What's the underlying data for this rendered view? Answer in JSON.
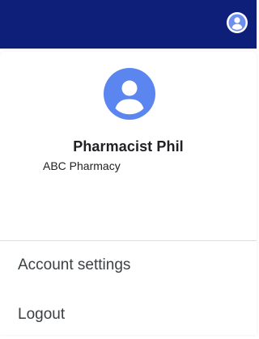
{
  "header": {
    "avatar_icon": "account-circle-icon",
    "background_color": "#0d1f78"
  },
  "account_menu": {
    "avatar_icon": "account-circle-icon",
    "avatar_color": "#5b86f0",
    "user_name": "Pharmacist Phil",
    "pharmacy_name": "ABC Pharmacy",
    "items": [
      {
        "label": "Account settings"
      },
      {
        "label": "Logout"
      }
    ]
  }
}
